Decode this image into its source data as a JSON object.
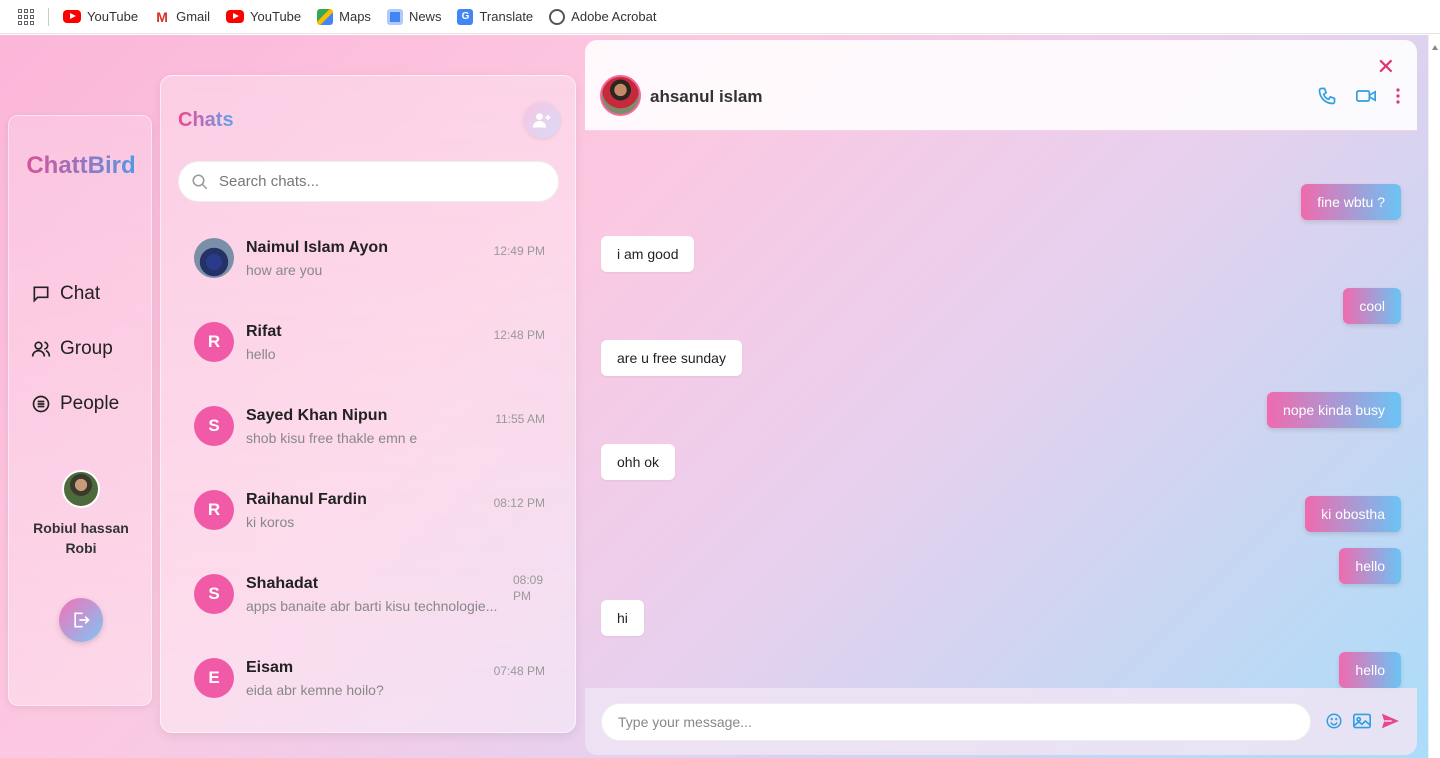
{
  "bookmarks": [
    {
      "label": "YouTube",
      "icon": "youtube-icon"
    },
    {
      "label": "Gmail",
      "icon": "gmail-icon"
    },
    {
      "label": "YouTube",
      "icon": "youtube-icon"
    },
    {
      "label": "Maps",
      "icon": "maps-icon"
    },
    {
      "label": "News",
      "icon": "news-icon"
    },
    {
      "label": "Translate",
      "icon": "translate-icon"
    },
    {
      "label": "Adobe Acrobat",
      "icon": "acrobat-icon"
    }
  ],
  "sidebar": {
    "brand": "ChattBird",
    "nav": [
      {
        "label": "Chat",
        "icon": "chat-bubble-icon"
      },
      {
        "label": "Group",
        "icon": "group-icon"
      },
      {
        "label": "People",
        "icon": "people-list-icon"
      }
    ],
    "user_name": "Robiul hassan Robi"
  },
  "chats": {
    "title": "Chats",
    "search_placeholder": "Search chats...",
    "items": [
      {
        "name": "Naimul Islam Ayon",
        "last": "how are you",
        "time": "12:49 PM",
        "initial": ""
      },
      {
        "name": "Rifat",
        "last": "hello",
        "time": "12:48 PM",
        "initial": "R"
      },
      {
        "name": "Sayed Khan Nipun",
        "last": "shob kisu free thakle emn e",
        "time": "11:55 AM",
        "initial": "S"
      },
      {
        "name": "Raihanul Fardin",
        "last": "ki koros",
        "time": "08:12 PM",
        "initial": "R"
      },
      {
        "name": "Shahadat",
        "last": "apps banaite abr barti kisu technologie...",
        "time": "08:09 PM",
        "initial": "S"
      },
      {
        "name": "Eisam",
        "last": "eida abr kemne hoilo?",
        "time": "07:48 PM",
        "initial": "E"
      }
    ]
  },
  "conversation": {
    "contact_name": "ahsanul islam",
    "messages": [
      {
        "text": "fine wbtu ?",
        "dir": "out"
      },
      {
        "text": "i am good",
        "dir": "in"
      },
      {
        "text": "cool",
        "dir": "out"
      },
      {
        "text": "are u free sunday",
        "dir": "in"
      },
      {
        "text": "nope kinda busy",
        "dir": "out"
      },
      {
        "text": "ohh ok",
        "dir": "in"
      },
      {
        "text": "ki obostha",
        "dir": "out"
      },
      {
        "text": "hello",
        "dir": "out"
      },
      {
        "text": "hi",
        "dir": "in"
      },
      {
        "text": "hello",
        "dir": "out"
      }
    ],
    "input_placeholder": "Type your message..."
  },
  "colors": {
    "accent_pink": "#f0468f",
    "accent_blue": "#3aa4f0"
  }
}
